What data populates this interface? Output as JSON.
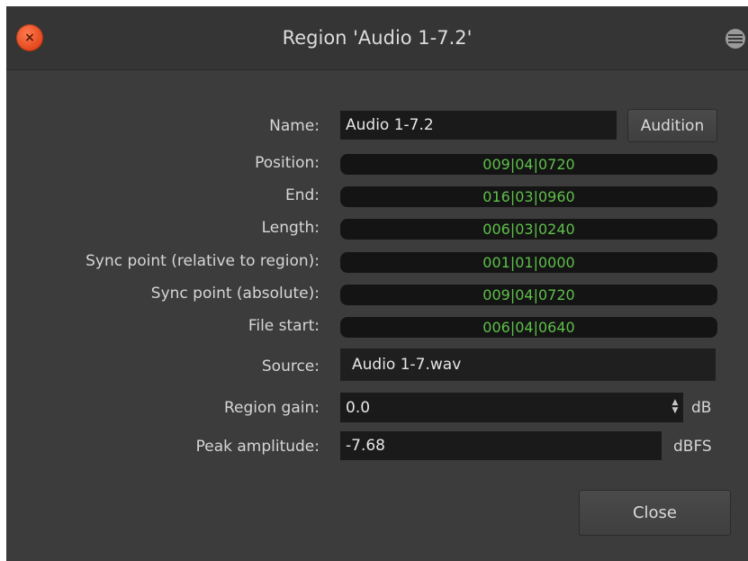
{
  "window": {
    "title": "Region 'Audio 1-7.2'",
    "close_glyph": "×",
    "close_icon": "close-icon",
    "menu_icon": "hamburger-menu-icon"
  },
  "form": {
    "name_label": "Name:",
    "name_value": "Audio 1-7.2",
    "audition_button": "Audition",
    "position_label": "Position:",
    "position_value": "009|04|0720",
    "end_label": "End:",
    "end_value": "016|03|0960",
    "length_label": "Length:",
    "length_value": "006|03|0240",
    "sync_rel_label": "Sync point (relative to region):",
    "sync_rel_value": "001|01|0000",
    "sync_abs_label": "Sync point (absolute):",
    "sync_abs_value": "009|04|0720",
    "file_start_label": "File start:",
    "file_start_value": "006|04|0640",
    "source_label": "Source:",
    "source_value": "Audio 1-7.wav",
    "gain_label": "Region gain:",
    "gain_value": "0.0",
    "gain_unit": "dB",
    "peak_label": "Peak amplitude:",
    "peak_value": "-7.68",
    "peak_unit": "dBFS"
  },
  "footer": {
    "close_button": "Close"
  },
  "colors": {
    "clock_text": "#5ec04a",
    "window_bg": "#3c3c3c",
    "field_bg": "#1a1a1a",
    "close_circle": "#e3461b"
  }
}
